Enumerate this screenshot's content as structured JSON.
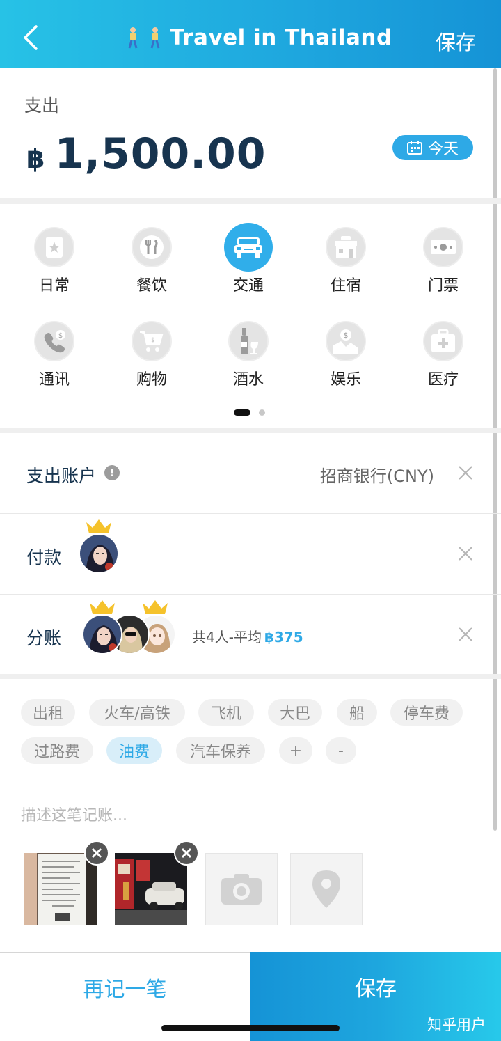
{
  "header": {
    "title": "Travel in Thailand",
    "save_label": "保存"
  },
  "amount": {
    "label": "支出",
    "currency": "฿",
    "value": "1,500.00",
    "date_label": "今天"
  },
  "categories": [
    {
      "label": "日常",
      "icon": "daily-icon"
    },
    {
      "label": "餐饮",
      "icon": "dining-icon"
    },
    {
      "label": "交通",
      "icon": "car-icon",
      "selected": true
    },
    {
      "label": "住宿",
      "icon": "hotel-icon"
    },
    {
      "label": "门票",
      "icon": "ticket-icon"
    },
    {
      "label": "通讯",
      "icon": "phone-icon"
    },
    {
      "label": "购物",
      "icon": "cart-icon"
    },
    {
      "label": "酒水",
      "icon": "drinks-icon"
    },
    {
      "label": "娱乐",
      "icon": "entertainment-icon"
    },
    {
      "label": "医疗",
      "icon": "medical-icon"
    }
  ],
  "pager": {
    "pages": 2,
    "current": 1
  },
  "account": {
    "label": "支出账户",
    "info": "!",
    "value": "招商银行(CNY)"
  },
  "payer": {
    "label": "付款"
  },
  "split": {
    "label": "分账",
    "summary": "共4人-平均",
    "average": "฿375"
  },
  "tags": {
    "items": [
      "出租",
      "火车/高铁",
      "飞机",
      "大巴",
      "船",
      "停车费",
      "过路费",
      "油费",
      "汽车保养",
      "+",
      "-"
    ],
    "selected": "油费"
  },
  "description": {
    "placeholder": "描述这笔记账..."
  },
  "bottom": {
    "again_label": "再记一笔",
    "save_label": "保存"
  },
  "watermark": "知乎用户",
  "colors": {
    "accent": "#2ea9e6",
    "header_start": "#27c2e6",
    "header_end": "#1593d6",
    "amount_text": "#17344f"
  }
}
